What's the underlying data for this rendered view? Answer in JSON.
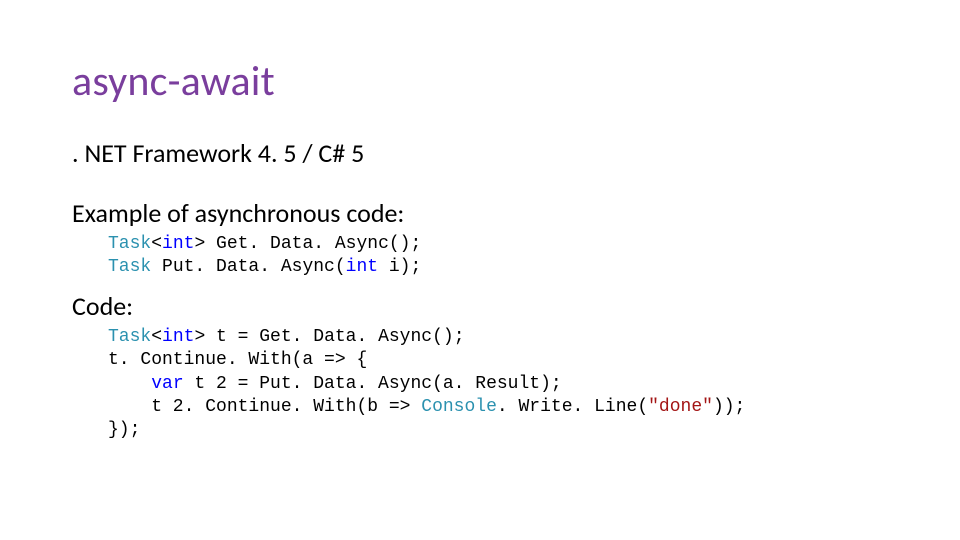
{
  "title": "async-await",
  "framework_line": ". NET Framework 4. 5 / C# 5",
  "example_heading": "Example of asynchronous code:",
  "code_heading": "Code:",
  "sig": {
    "l1": {
      "task": "Task",
      "lt": "<",
      "int": "int",
      "gt": ">",
      "rest": " Get. Data. Async();"
    },
    "l2": {
      "task": "Task",
      "rest1": " Put. Data. Async(",
      "int": "int",
      "rest2": " i);"
    }
  },
  "code": {
    "l1": {
      "task": "Task",
      "lt": "<",
      "int": "int",
      "gt": ">",
      "rest": " t = Get. Data. Async();"
    },
    "l2": "t. Continue. With(a => {",
    "l3_a": "    ",
    "l3_var": "var",
    "l3_b": " t 2 = Put. Data. Async(a. Result);",
    "l4_a": "    t 2. Continue. With(b => ",
    "l4_console": "Console",
    "l4_b": ". Write. Line(",
    "l4_str": "\"done\"",
    "l4_c": "));",
    "l5": "});"
  }
}
